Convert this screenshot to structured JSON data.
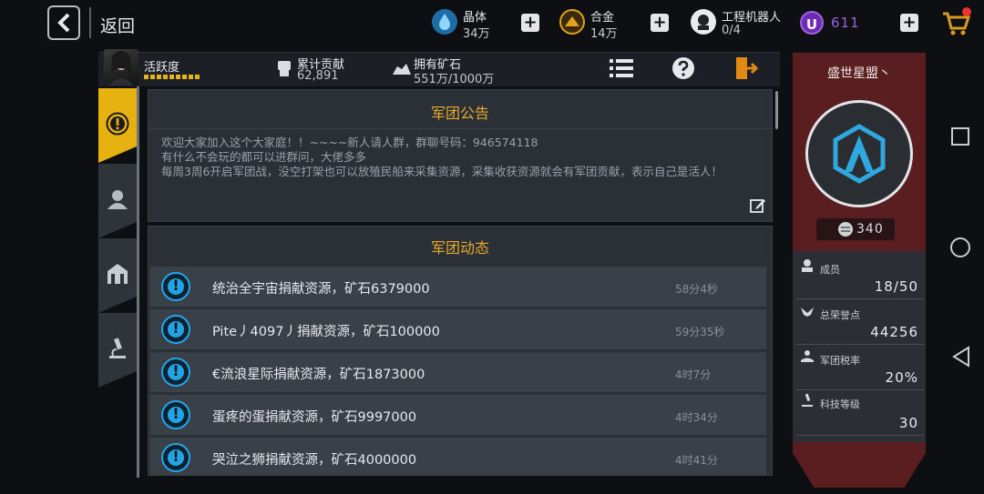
{
  "topbar": {
    "back_label": "返回",
    "resources": [
      {
        "name": "晶体",
        "value": "34万",
        "color": "#3aa6e8",
        "icon": "crystal-icon"
      },
      {
        "name": "合金",
        "value": "14万",
        "color": "#e0a21a",
        "icon": "alloy-icon"
      },
      {
        "name": "工程机器人",
        "value": "0/4",
        "color": "#ffffff",
        "icon": "robot-icon"
      }
    ],
    "premium": {
      "badge": "U",
      "value": "611",
      "color": "#9b62e0"
    }
  },
  "header": {
    "activity_label": "活跃度",
    "contribution_label": "累计贡献",
    "contribution_value": "62,891",
    "ore_label": "拥有矿石",
    "ore_value": "551万/1000万"
  },
  "tabs": [
    {
      "icon": "notice-icon",
      "active": true
    },
    {
      "icon": "members-icon",
      "active": false
    },
    {
      "icon": "building-icon",
      "active": false
    },
    {
      "icon": "science-icon",
      "active": false
    }
  ],
  "notice": {
    "title": "军团公告",
    "lines": [
      "欢迎大家加入这个大家庭！！~~~~新人请人群，群聊号码：946574118",
      "有什么不会玩的都可以进群问，大佬多多",
      "每周3周6开启军团战，没空打架也可以放殖民船来采集资源，采集收获资源就会有军团贡献，表示自己是活人！"
    ]
  },
  "dynamics": {
    "title": "军团动态",
    "rows": [
      {
        "text": "统治全宇宙捐献资源，矿石6379000",
        "time": "58分4秒"
      },
      {
        "text": "Pite丿4097丿捐献资源，矿石100000",
        "time": "59分35秒"
      },
      {
        "text": "€流浪星际捐献资源，矿石1873000",
        "time": "4时7分"
      },
      {
        "text": "蛋疼的蛋捐献资源，矿石9997000",
        "time": "4时34分"
      },
      {
        "text": "哭泣之狮捐献资源，矿石4000000",
        "time": "4时41分"
      }
    ]
  },
  "alliance": {
    "name": "盛世星盟丶",
    "score": "340",
    "stats": [
      {
        "label": "成员",
        "value": "18/50",
        "icon": "member-icon"
      },
      {
        "label": "总荣誉点",
        "value": "44256",
        "icon": "wings-icon"
      },
      {
        "label": "军团税率",
        "value": "20%",
        "icon": "tax-icon"
      },
      {
        "label": "科技等级",
        "value": "30",
        "icon": "microscope-icon"
      }
    ]
  },
  "colors": {
    "accent": "#e7b20f",
    "title": "#e6a92a",
    "info": "#22a4e2",
    "alliance_bg": "#5a1e21"
  }
}
